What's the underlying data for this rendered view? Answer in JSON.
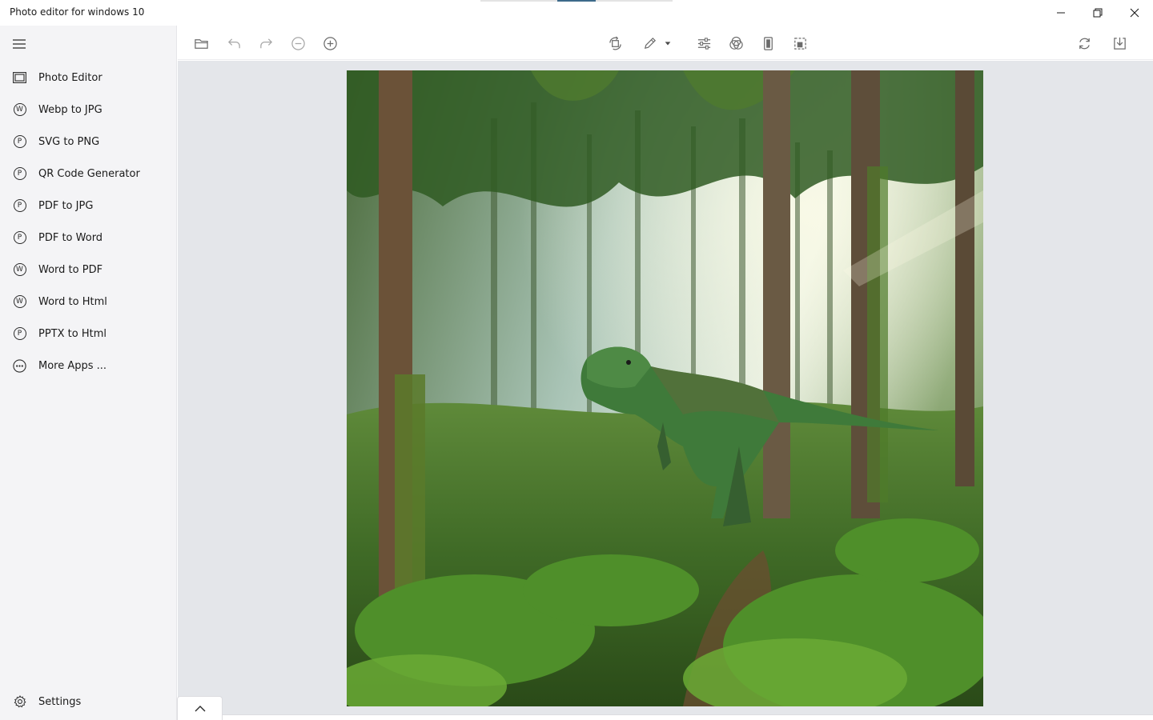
{
  "window": {
    "title": "Photo editor for windows 10"
  },
  "sidebar": {
    "items": [
      {
        "label": "Photo Editor",
        "icon": "photo-editor-icon"
      },
      {
        "label": "Webp to JPG",
        "icon": "w-circle-icon",
        "glyph": "W"
      },
      {
        "label": "SVG to PNG",
        "icon": "p-circle-icon",
        "glyph": "P"
      },
      {
        "label": "QR Code Generator",
        "icon": "p-circle-icon",
        "glyph": "P"
      },
      {
        "label": "PDF to JPG",
        "icon": "p-circle-icon",
        "glyph": "P"
      },
      {
        "label": "PDF to Word",
        "icon": "p-circle-icon",
        "glyph": "P"
      },
      {
        "label": "Word to PDF",
        "icon": "w-circle-icon",
        "glyph": "W"
      },
      {
        "label": "Word to Html",
        "icon": "w-circle-icon",
        "glyph": "W"
      },
      {
        "label": "PPTX to Html",
        "icon": "p-circle-icon",
        "glyph": "P"
      },
      {
        "label": "More Apps ...",
        "icon": "more-apps-icon"
      }
    ],
    "settings_label": "Settings"
  },
  "toolbar": {
    "left_icons": [
      "folder-icon",
      "undo-icon",
      "redo-icon",
      "zoom-out-icon",
      "zoom-in-icon"
    ],
    "center_icons": [
      "rotate-icon",
      "pencil-icon",
      "dropdown-arrow-icon",
      "adjust-sliders-icon",
      "filter-icon",
      "crop-portrait-icon",
      "crop-frame-icon"
    ],
    "right_icons": [
      "refresh-icon",
      "save-download-icon"
    ]
  },
  "canvas": {
    "image_subject": "dinosaur-forest-photo",
    "background": "#e4e6ea"
  },
  "colors": {
    "accent": "#3d6a8a",
    "sidebar_bg": "#f4f4f6",
    "icon": "#6b6b6b"
  }
}
